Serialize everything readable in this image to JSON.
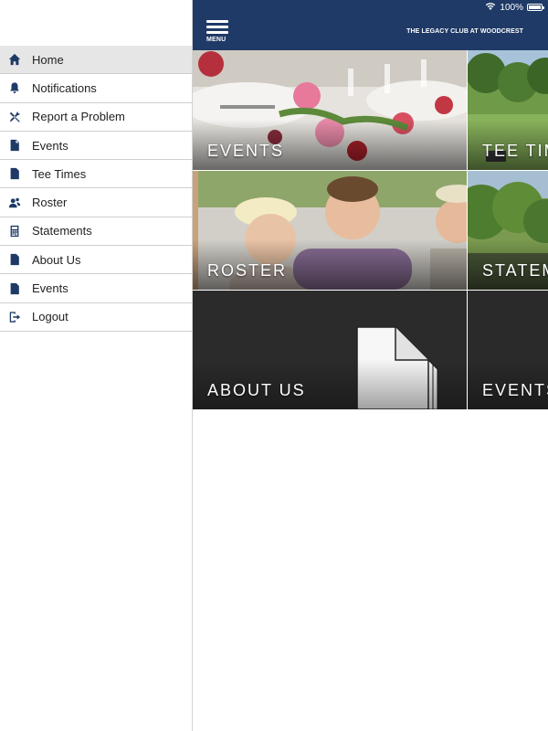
{
  "status_bar": {
    "battery": "100%"
  },
  "header": {
    "menu_label": "MENU",
    "club_title": "THE LEGACY CLUB AT WOODCREST"
  },
  "menu": {
    "items": [
      {
        "label": "Home",
        "icon": "home-icon",
        "active": true
      },
      {
        "label": "Notifications",
        "icon": "bell-icon"
      },
      {
        "label": "Report a Problem",
        "icon": "tools-icon"
      },
      {
        "label": "Events",
        "icon": "document-icon"
      },
      {
        "label": "Tee Times",
        "icon": "document-icon"
      },
      {
        "label": "Roster",
        "icon": "people-icon"
      },
      {
        "label": "Statements",
        "icon": "calculator-icon"
      },
      {
        "label": "About Us",
        "icon": "document-icon"
      },
      {
        "label": "Events",
        "icon": "document-icon"
      },
      {
        "label": "Logout",
        "icon": "logout-icon"
      }
    ]
  },
  "tiles": {
    "events": "EVENTS",
    "tee_times": "TEE TIMES",
    "roster": "ROSTER",
    "statements": "STATEMENTS",
    "about_us": "ABOUT US",
    "events_2": "EVENTS"
  },
  "colors": {
    "brand": "#1f3a66",
    "active_row": "#e6e6e6",
    "tile_dark": "#2a2a2a"
  }
}
